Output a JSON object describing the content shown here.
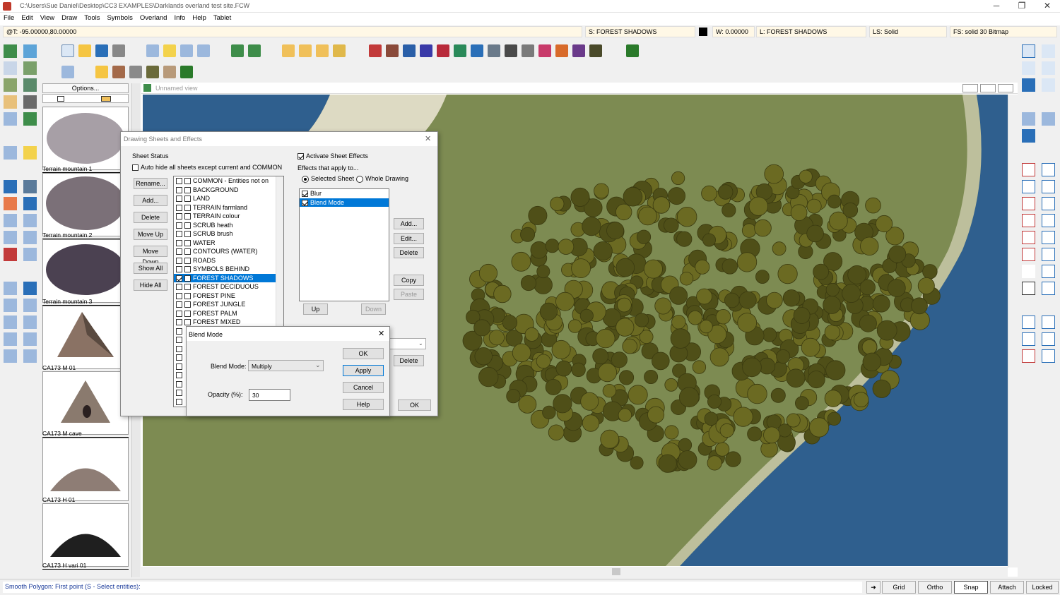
{
  "window": {
    "title": "C:\\Users\\Sue Daniel\\Desktop\\CC3 EXAMPLES\\Darklands overland test site.FCW",
    "minimize": "─",
    "maximize": "❐",
    "close": "✕"
  },
  "menu": [
    "File",
    "Edit",
    "View",
    "Draw",
    "Tools",
    "Symbols",
    "Overland",
    "Info",
    "Help",
    "Tablet"
  ],
  "status_fields": {
    "coords": "@T: -95.00000,80.00000",
    "sheet": "S: FOREST SHADOWS",
    "width": "W: 0.00000",
    "layer": "L: FOREST SHADOWS",
    "linestyle": "LS: Solid",
    "fillstyle": "FS: solid 30 Bitmap"
  },
  "catalog": {
    "options_label": "Options...",
    "symbols": [
      {
        "label": "Terrain mountain 1"
      },
      {
        "label": "Terrain mountain 2"
      },
      {
        "label": "Terrain mountain 3"
      },
      {
        "label": "CA173 M 01"
      },
      {
        "label": "CA173 M cave"
      },
      {
        "label": "CA173 H 01"
      },
      {
        "label": "CA173 H vari 01"
      }
    ]
  },
  "map_view": {
    "title": "Unnamed view"
  },
  "sheets_dialog": {
    "title": "Drawing Sheets and Effects",
    "sheet_status_label": "Sheet Status",
    "autohide_label": "Auto hide all sheets except current and COMMON",
    "buttons": {
      "rename": "Rename...",
      "add": "Add...",
      "delete": "Delete",
      "move_up": "Move Up",
      "move_down": "Move Down",
      "show_all": "Show All",
      "hide_all": "Hide All"
    },
    "sheets": [
      {
        "name": "COMMON - Entities not on",
        "checked": false
      },
      {
        "name": "BACKGROUND",
        "checked": false
      },
      {
        "name": "LAND",
        "checked": false
      },
      {
        "name": "TERRAIN farmland",
        "checked": false
      },
      {
        "name": "TERRAIN colour",
        "checked": false
      },
      {
        "name": "SCRUB heath",
        "checked": false
      },
      {
        "name": "SCRUB brush",
        "checked": false
      },
      {
        "name": "WATER",
        "checked": false
      },
      {
        "name": "CONTOURS (WATER)",
        "checked": false
      },
      {
        "name": "ROADS",
        "checked": false
      },
      {
        "name": "SYMBOLS BEHIND",
        "checked": false
      },
      {
        "name": "FOREST SHADOWS",
        "checked": true,
        "selected": true
      },
      {
        "name": "FOREST DECIDUOUS",
        "checked": false
      },
      {
        "name": "FOREST PINE",
        "checked": false
      },
      {
        "name": "FOREST JUNGLE",
        "checked": false
      },
      {
        "name": "FOREST PALM",
        "checked": false
      },
      {
        "name": "FOREST MIXED",
        "checked": false
      }
    ],
    "activate_effects_label": "Activate Sheet Effects",
    "effects_apply_label": "Effects that apply to...",
    "selected_sheet_label": "Selected Sheet",
    "whole_drawing_label": "Whole Drawing",
    "effects": [
      {
        "name": "Blur",
        "checked": true
      },
      {
        "name": "Blend Mode",
        "checked": true,
        "selected": true
      }
    ],
    "effect_buttons": {
      "add": "Add...",
      "edit": "Edit...",
      "delete": "Delete",
      "copy": "Copy",
      "paste": "Paste",
      "up": "Up",
      "down": "Down"
    },
    "lower_delete": "Delete",
    "ok": "OK"
  },
  "blend_dialog": {
    "title": "Blend Mode",
    "mode_label": "Blend Mode:",
    "mode_value": "Multiply",
    "opacity_label": "Opacity (%):",
    "opacity_value": "30",
    "ok": "OK",
    "apply": "Apply",
    "cancel": "Cancel",
    "help": "Help"
  },
  "bottom": {
    "prompt": "Smooth Polygon: First point (S - Select entities):",
    "buttons": [
      "Grid",
      "Ortho",
      "Snap",
      "Attach",
      "Locked"
    ]
  },
  "colors": {
    "water": "#2f5f8e",
    "land": "#7d8b52",
    "sand": "#e8e2cf",
    "selection": "#0078d7",
    "forest": "#5a5a1e"
  }
}
